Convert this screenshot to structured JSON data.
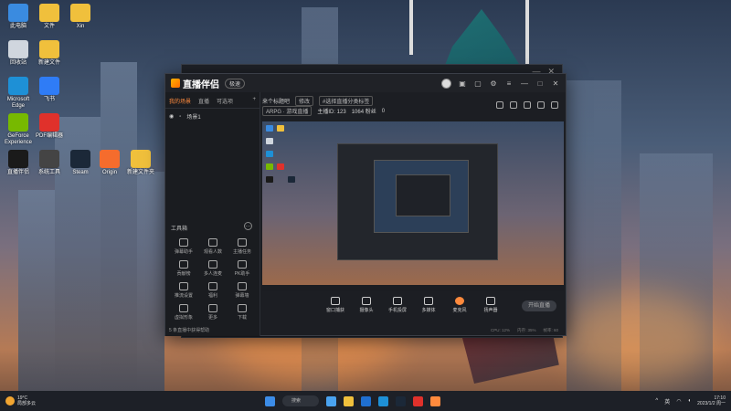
{
  "desktop": {
    "icons": [
      {
        "label": "此电脑",
        "color": "#3a8be0"
      },
      {
        "label": "文件",
        "color": "#f0c03c"
      },
      {
        "label": "Xin",
        "color": "#f0c03c"
      },
      {
        "label": "回收站",
        "color": "#d0d6de"
      },
      {
        "label": "新建文件",
        "color": "#f0c03c"
      },
      {
        "label": "Microsoft Edge",
        "color": "#1e90d6"
      },
      {
        "label": "飞书",
        "color": "#2f7cf6"
      },
      {
        "label": "GeForce Experience",
        "color": "#77b900"
      },
      {
        "label": "PDF编辑器",
        "color": "#e0312b"
      },
      {
        "label": "直播伴侣",
        "color": "#1a1a1a"
      },
      {
        "label": "系统工具",
        "color": "#444"
      },
      {
        "label": "Steam",
        "color": "#1b2838"
      },
      {
        "label": "Origin",
        "color": "#f56c2d"
      },
      {
        "label": "新建文件夹",
        "color": "#f0c03c"
      }
    ]
  },
  "app": {
    "name": "直播伴侣",
    "version_badge": "极速",
    "window_controls": [
      "—",
      "□",
      "✕"
    ]
  },
  "left_panel": {
    "tabs": [
      "我的场景",
      "直播",
      "可选项"
    ],
    "add_label": "+",
    "scene_name": "场景1",
    "toolbox_title": "工具箱",
    "tools": [
      "弹幕助手",
      "观看人数",
      "主播任务",
      "贡献榜",
      "多人连麦",
      "PK助手",
      "推流设置",
      "福利",
      "弹幕墙",
      "虚拟形象",
      "更多",
      "下载"
    ],
    "footer": "5 条直播中获得帮助"
  },
  "info": {
    "title": "来个标题吧",
    "edit_chip": "修改",
    "category_chip": "#选择直播分类标签",
    "tag1": "ARPG · 游戏直播",
    "room_id": "主播ID: 123",
    "followers": "1064 粉丝",
    "likes": "0"
  },
  "controls": [
    {
      "label": "窗口捕获",
      "icon": "screen-icon"
    },
    {
      "label": "摄像头",
      "icon": "camera-icon"
    },
    {
      "label": "手机投屏",
      "icon": "phone-icon"
    },
    {
      "label": "多媒体",
      "icon": "media-icon"
    },
    {
      "label": "麦克风",
      "icon": "mic-icon"
    },
    {
      "label": "扬声器",
      "icon": "speaker-icon"
    }
  ],
  "live_button": "开始直播",
  "status": [
    "CPU: 12%",
    "内存: 35%",
    "帧率: 60"
  ],
  "taskbar": {
    "weather_temp": "19°C",
    "weather_text": "局部多云",
    "search": "搜索",
    "apps": [
      "#4aa3f0",
      "#f0c03c",
      "#1f6fd0",
      "#1e90d6",
      "#1b2838",
      "#e0312b",
      "#ff8a3d"
    ],
    "tray_lang": "英",
    "time": "17:10",
    "date": "2023/1/2 周一"
  }
}
